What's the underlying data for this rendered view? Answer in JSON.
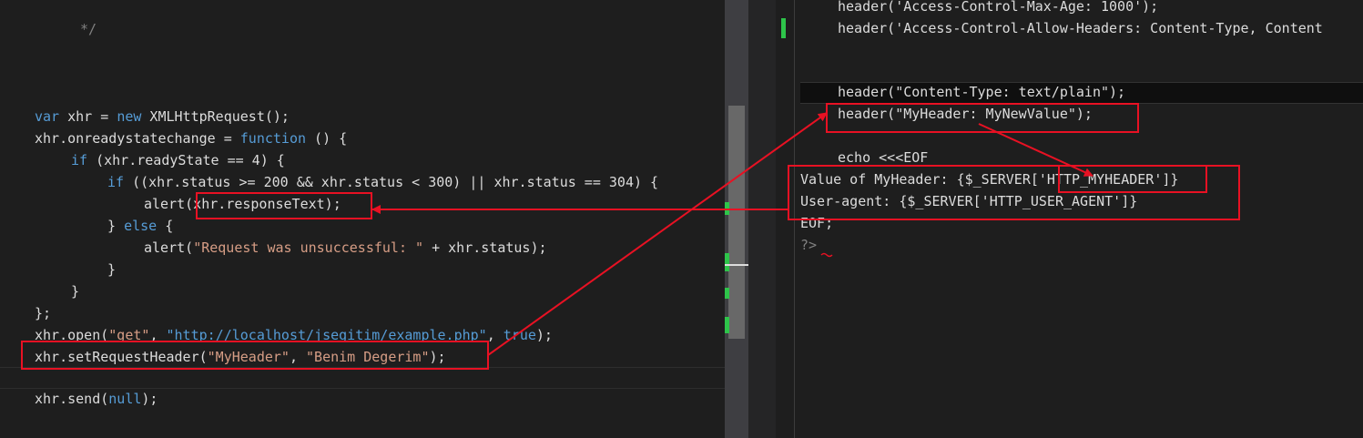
{
  "left_code": {
    "comment_close": "*/",
    "line1": [
      "var",
      " xhr = ",
      "new",
      " XMLHttpRequest();"
    ],
    "line2": [
      "xhr.onreadystatechange = ",
      "function",
      " () {"
    ],
    "line3": [
      "if",
      " (xhr.readyState == 4) {"
    ],
    "line4": [
      "if",
      " ((xhr.status >= 200 && xhr.status < 300) || xhr.status == 304) {"
    ],
    "line5": "alert(xhr.responseText);",
    "line6": [
      "} ",
      "else",
      " {"
    ],
    "line7": [
      "alert(",
      "\"Request was unsuccessful: \"",
      " + xhr.status);"
    ],
    "line8": "}",
    "line9": "}",
    "line10": "};",
    "line11": [
      "xhr.open(",
      "\"get\"",
      ", ",
      "\"http://localhost/jsegitim/example.php\"",
      ", ",
      "true",
      ");"
    ],
    "line12": [
      "xhr.setRequestHeader(",
      "\"MyHeader\"",
      ", ",
      "\"Benim Degerim\"",
      ");"
    ],
    "line13": [
      "xhr.send(",
      "null",
      ");"
    ]
  },
  "right_code": {
    "line1": "header('Access-Control-Max-Age: 1000');",
    "line2": "header('Access-Control-Allow-Headers: Content-Type, Content",
    "line3": "header(\"Content-Type: text/plain\");",
    "line4": "header(\"MyHeader: MyNewValue\");",
    "line5": "echo <<<EOF",
    "line6": "Value of MyHeader: {$_SERVER['HTTP_MYHEADER']}",
    "line7": "User-agent: {$_SERVER['HTTP_USER_AGENT']}",
    "line8": "EOF;",
    "line9": "?>"
  },
  "colors": {
    "background": "#1e1e1e",
    "keyword": "#569cd6",
    "string": "#d69d85",
    "annotation": "#e81123",
    "change_marker": "#2ec44a"
  }
}
